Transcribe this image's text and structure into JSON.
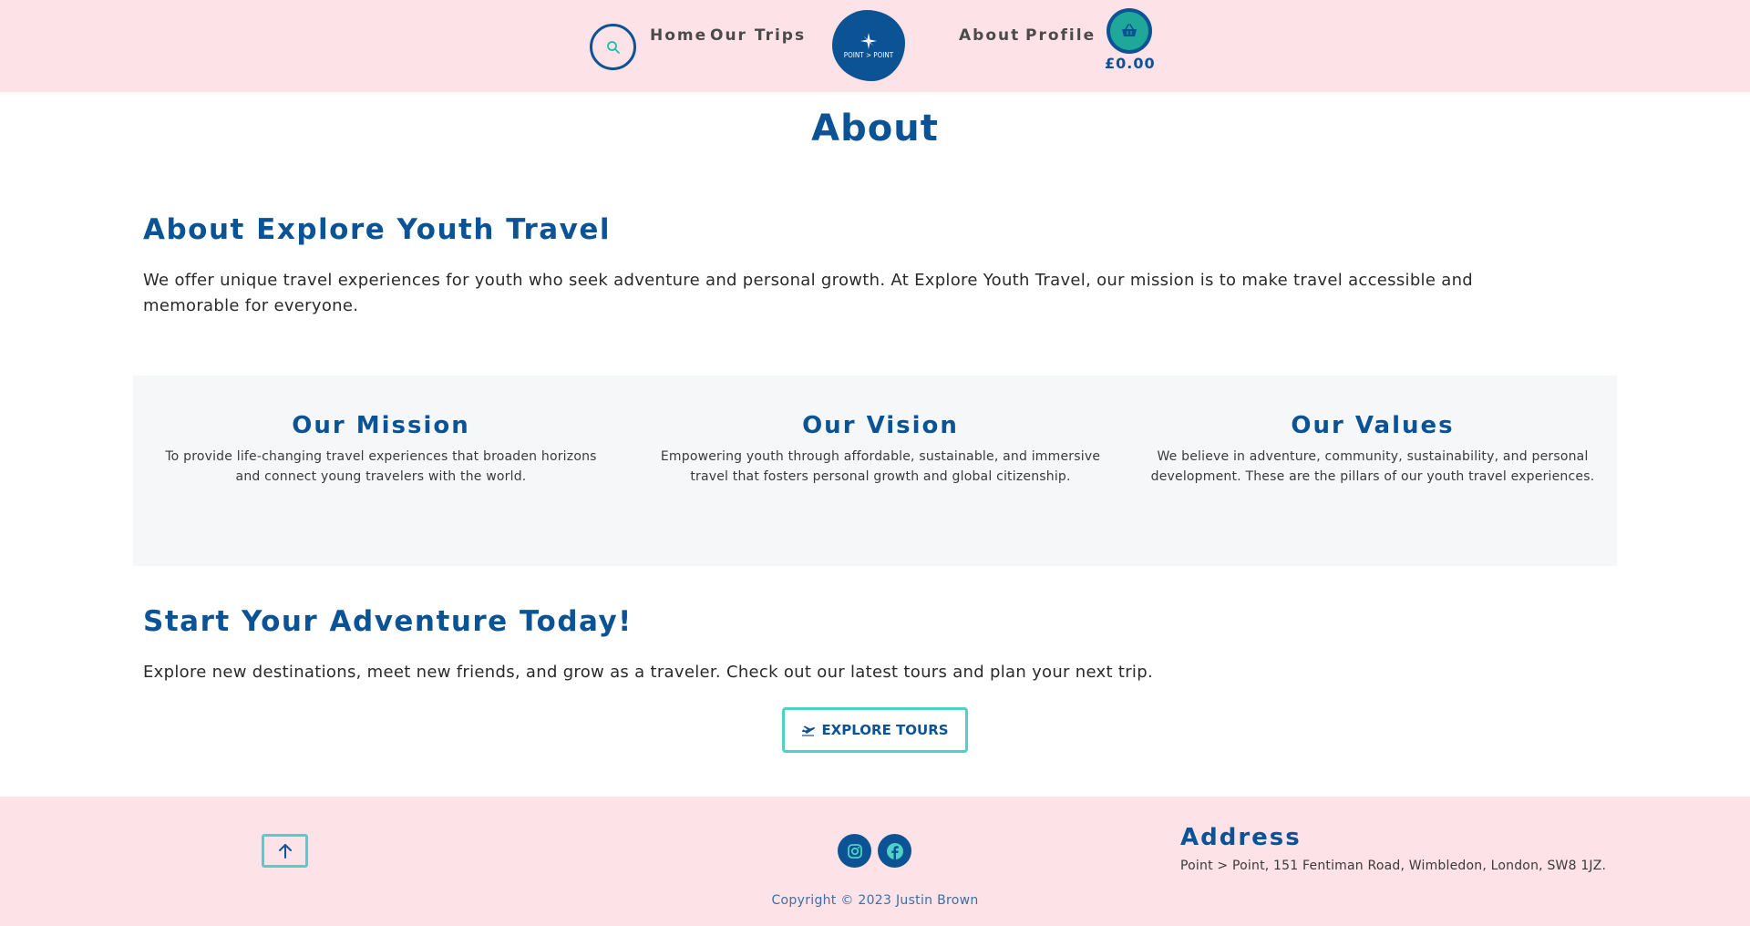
{
  "header": {
    "search_icon": "magnifier-icon",
    "nav_left": [
      {
        "label": "Home"
      },
      {
        "label": "Our Trips"
      }
    ],
    "logo_text": "POINT > POINT",
    "nav_right": [
      {
        "label": "About"
      },
      {
        "label": "Profile"
      }
    ],
    "cart_icon": "basket-icon",
    "cart_total": "£0.00"
  },
  "main": {
    "page_title": "About",
    "intro": {
      "heading": "About Explore Youth Travel",
      "text": "We offer unique travel experiences for youth who seek adventure and personal growth. At Explore Youth Travel, our mission is to make travel accessible and memorable for everyone."
    },
    "features": [
      {
        "title": "Our Mission",
        "text": "To provide life-changing travel experiences that broaden horizons and connect young travelers with the world."
      },
      {
        "title": "Our Vision",
        "text": "Empowering youth through affordable, sustainable, and immersive travel that fosters personal growth and global citizenship."
      },
      {
        "title": "Our Values",
        "text": "We believe in adventure, community, sustainability, and personal development. These are the pillars of our youth travel experiences."
      }
    ],
    "cta": {
      "heading": "Start Your Adventure Today!",
      "text": "Explore new destinations, meet new friends, and grow as a traveler. Check out our latest tours and plan your next trip.",
      "button_label": "EXPLORE TOURS",
      "button_icon": "plane-departure-icon"
    }
  },
  "footer": {
    "top_button_icon": "arrow-up-icon",
    "social": [
      {
        "icon": "instagram-icon"
      },
      {
        "icon": "facebook-icon"
      }
    ],
    "address_title": "Address",
    "address_text": "Point > Point, 151 Fentiman Road, Wimbledon, London, SW8 1JZ.",
    "copyright": "Copyright © 2023 Justin Brown"
  },
  "colors": {
    "primary": "#0b5394",
    "accent": "#4fd1c5",
    "header_bg": "#fde2e7",
    "panel_bg": "#f5f7f9"
  }
}
